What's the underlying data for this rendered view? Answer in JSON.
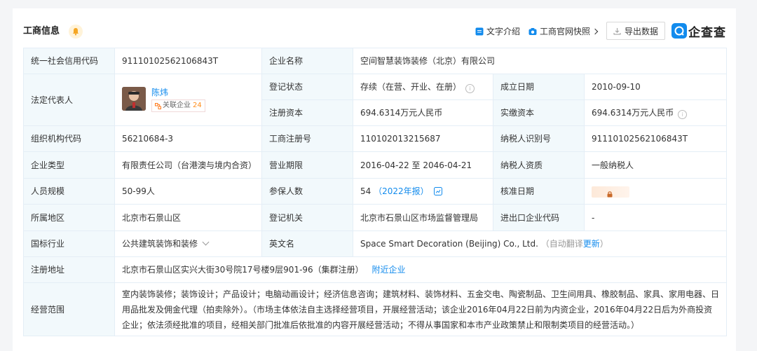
{
  "header": {
    "title": "工商信息",
    "text_intro": "文字介绍",
    "snapshot": "工商官网快照",
    "export": "导出数据",
    "brand": "企查查"
  },
  "colors": {
    "accent": "#128bed",
    "label_bg": "#f2f9fc",
    "border": "#e4eef6",
    "badge": "#ff8c1a"
  },
  "labels": {
    "credit_code": "统一社会信用代码",
    "company_name": "企业名称",
    "legal_rep": "法定代表人",
    "reg_status": "登记状态",
    "found_date": "成立日期",
    "reg_capital": "注册资本",
    "paid_capital": "实缴资本",
    "org_code": "组织机构代码",
    "reg_no": "工商注册号",
    "taxpayer_id": "纳税人识别号",
    "company_type": "企业类型",
    "biz_term": "营业期限",
    "taxpayer_qual": "纳税人资质",
    "staff_size": "人员规模",
    "insured": "参保人数",
    "approval_date": "核准日期",
    "region": "所属地区",
    "reg_authority": "登记机关",
    "import_export": "进出口企业代码",
    "industry": "国标行业",
    "english_name": "英文名",
    "reg_address": "注册地址",
    "biz_scope": "经营范围"
  },
  "values": {
    "credit_code": "91110102562106843T",
    "company_name": "空间智慧装饰装修（北京）有限公司",
    "legal_rep_name": "陈炜",
    "related_label": "关联企业",
    "related_count": "24",
    "reg_status": "存续（在营、开业、在册）",
    "found_date": "2010-09-10",
    "reg_capital": "694.6314万元人民币",
    "paid_capital": "694.6314万元人民币",
    "org_code": "56210684-3",
    "reg_no": "110102013215687",
    "taxpayer_id": "91110102562106843T",
    "company_type": "有限责任公司（台港澳与境内合资）",
    "biz_term": "2016-04-22 至 2046-04-21",
    "taxpayer_qual": "一般纳税人",
    "staff_size": "50-99人",
    "insured": "54",
    "insured_report": "（2022年报）",
    "region": "北京市石景山区",
    "reg_authority": "北京市石景山区市场监督管理局",
    "import_export": "-",
    "industry": "公共建筑装饰和装修",
    "english_name": "Space Smart Decoration (Beijing) Co., Ltd.",
    "auto_translate": "（自动翻译",
    "update": "更新",
    "close_paren": "）",
    "reg_address": "北京市石景山区实兴大街30号院17号楼9层901-96（集群注册）",
    "nearby": "附近企业",
    "biz_scope": "室内装饰装修；装饰设计；产品设计；电脑动画设计；经济信息咨询；建筑材料、装饰材料、五金交电、陶瓷制品、卫生间用具、橡胶制品、家具、家用电器、日用品批发及佣金代理（拍卖除外）。（市场主体依法自主选择经营项目，开展经营活动；该企业2016年04月22日前为内资企业，2016年04月22日后为外商投资企业；依法须经批准的项目，经相关部门批准后依批准的内容开展经营活动；不得从事国家和本市产业政策禁止和限制类项目的经营活动。）"
  }
}
